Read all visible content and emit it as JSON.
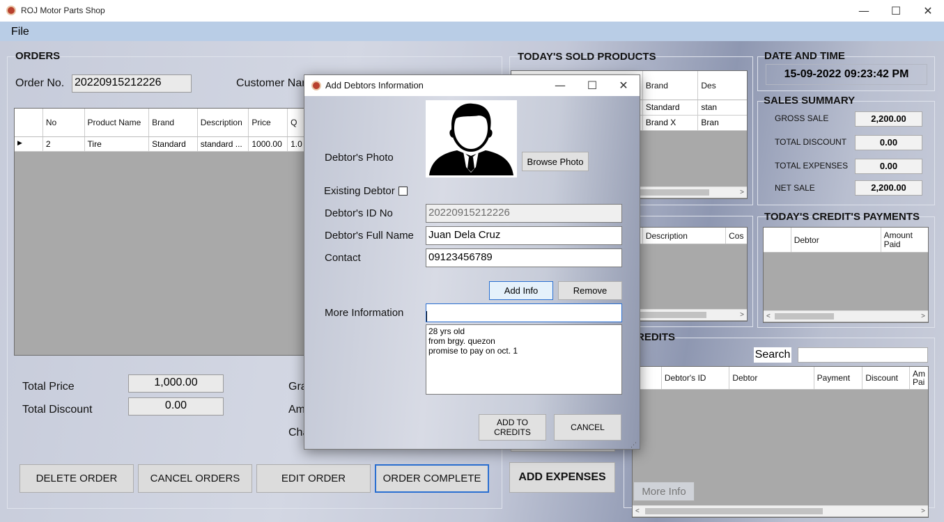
{
  "window": {
    "title": "ROJ Motor Parts Shop",
    "minimize_glyph": "—",
    "maximize_glyph": "☐",
    "close_glyph": "✕"
  },
  "menu": {
    "file": "File"
  },
  "orders": {
    "title": "ORDERS",
    "order_no_label": "Order No.",
    "order_no_value": "20220915212226",
    "customer_label": "Customer Nar",
    "columns": [
      "",
      "No",
      "Product Name",
      "Brand",
      "Description",
      "Price",
      "Q"
    ],
    "rows": [
      {
        "indicator": "▶",
        "no": "2",
        "product": "Tire",
        "brand": "Standard",
        "description": "standard ...",
        "price": "1000.00",
        "qty": "1.0"
      }
    ],
    "total_price_label": "Total Price",
    "total_price_value": "1,000.00",
    "total_discount_label": "Total Discount",
    "total_discount_value": "0.00",
    "grand_label": "Gra",
    "amount_label": "Am",
    "change_label": "Cha",
    "buttons": {
      "delete": "DELETE ORDER",
      "cancel": "CANCEL ORDERS",
      "edit": "EDIT ORDER",
      "complete": "ORDER COMPLETE"
    }
  },
  "sold": {
    "title": "TODAY'S SOLD PRODUCTS",
    "columns": [
      "e",
      "Brand",
      "Des"
    ],
    "rows": [
      {
        "brand": "Standard",
        "desc": "stan"
      },
      {
        "brand": "Brand X",
        "desc": "Bran"
      }
    ]
  },
  "expenses": {
    "columns": [
      "Description",
      "Cos"
    ],
    "add_button": "ADD EXPENSES"
  },
  "datetime": {
    "title": "DATE AND TIME",
    "value": "15-09-2022  09:23:42 PM"
  },
  "sales_summary": {
    "title": "SALES SUMMARY",
    "items": [
      {
        "label": "GROSS SALE",
        "value": "2,200.00"
      },
      {
        "label": "TOTAL DISCOUNT",
        "value": "0.00"
      },
      {
        "label": "TOTAL EXPENSES",
        "value": "0.00"
      },
      {
        "label": "NET SALE",
        "value": "2,200.00"
      }
    ]
  },
  "credit_payments": {
    "title": "TODAY'S CREDIT'S PAYMENTS",
    "columns": [
      "",
      "Debtor",
      "Amount Paid"
    ]
  },
  "credits": {
    "title": "REDITS",
    "search_label": "Search",
    "search_value": "",
    "columns": [
      "",
      "Debtor's ID",
      "Debtor",
      "Payment",
      "Discount",
      "Am Pai"
    ],
    "more_info": "More Info"
  },
  "dialog": {
    "title": "Add Debtors Information",
    "photo_label": "Debtor's Photo",
    "browse_photo": "Browse Photo",
    "existing_label": "Existing Debtor",
    "existing_checked": false,
    "id_label": "Debtor's ID No",
    "id_value": "20220915212226",
    "name_label": "Debtor's Full Name",
    "name_value": "Juan Dela Cruz",
    "contact_label": "Contact",
    "contact_value": "09123456789",
    "add_info": "Add Info",
    "remove": "Remove",
    "more_info_label": "More Information",
    "more_info_input": "",
    "info_lines": [
      "28 yrs old",
      "from brgy. quezon",
      "promise to pay on oct. 1"
    ],
    "add_to_credits": "ADD TO CREDITS",
    "cancel": "CANCEL"
  }
}
